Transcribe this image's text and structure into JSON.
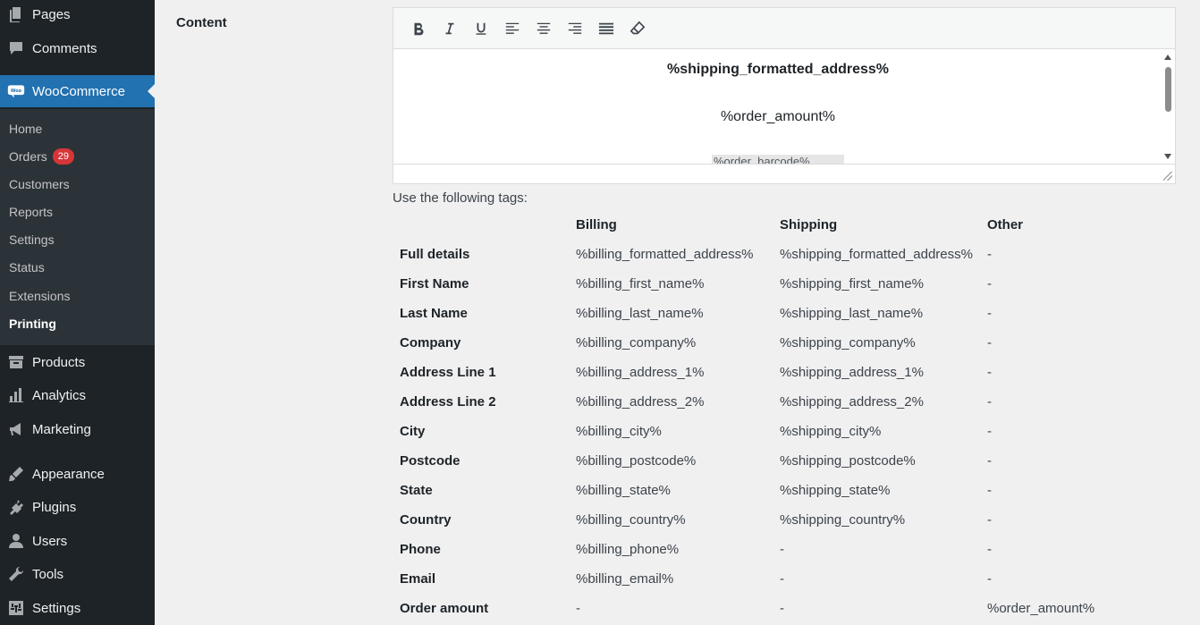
{
  "sidebar": {
    "top_items": [
      {
        "label": "Pages",
        "icon": "pages-icon"
      },
      {
        "label": "Comments",
        "icon": "comments-icon"
      }
    ],
    "woocommerce": {
      "label": "WooCommerce",
      "icon": "woocommerce-icon",
      "logo_text": "Woo"
    },
    "submenu": [
      {
        "label": "Home"
      },
      {
        "label": "Orders",
        "badge": "29"
      },
      {
        "label": "Customers"
      },
      {
        "label": "Reports"
      },
      {
        "label": "Settings"
      },
      {
        "label": "Status"
      },
      {
        "label": "Extensions"
      },
      {
        "label": "Printing",
        "current": true
      }
    ],
    "bottom_items": [
      {
        "label": "Products",
        "icon": "products-icon"
      },
      {
        "label": "Analytics",
        "icon": "analytics-icon"
      },
      {
        "label": "Marketing",
        "icon": "marketing-icon"
      },
      {
        "label": "Appearance",
        "icon": "appearance-icon"
      },
      {
        "label": "Plugins",
        "icon": "plugins-icon"
      },
      {
        "label": "Users",
        "icon": "users-icon"
      },
      {
        "label": "Tools",
        "icon": "tools-icon"
      },
      {
        "label": "Settings",
        "icon": "settings-icon"
      }
    ]
  },
  "content": {
    "label": "Content",
    "toolbar": [
      "bold-icon",
      "italic-icon",
      "underline-icon",
      "align-left-icon",
      "align-center-icon",
      "align-right-icon",
      "justify-icon",
      "clear-format-icon"
    ],
    "editor_lines": [
      "%shipping_formatted_address%",
      "%order_amount%",
      "%order_barcode%"
    ],
    "tags_hint": "Use the following tags:"
  },
  "tags_table": {
    "headers": [
      "",
      "Billing",
      "Shipping",
      "Other"
    ],
    "rows": [
      [
        "Full details",
        "%billing_formatted_address%",
        "%shipping_formatted_address%",
        "-"
      ],
      [
        "First Name",
        "%billing_first_name%",
        "%shipping_first_name%",
        "-"
      ],
      [
        "Last Name",
        "%billing_last_name%",
        "%shipping_last_name%",
        "-"
      ],
      [
        "Company",
        "%billing_company%",
        "%shipping_company%",
        "-"
      ],
      [
        "Address Line 1",
        "%billing_address_1%",
        "%shipping_address_1%",
        "-"
      ],
      [
        "Address Line 2",
        "%billing_address_2%",
        "%shipping_address_2%",
        "-"
      ],
      [
        "City",
        "%billing_city%",
        "%shipping_city%",
        "-"
      ],
      [
        "Postcode",
        "%billing_postcode%",
        "%shipping_postcode%",
        "-"
      ],
      [
        "State",
        "%billing_state%",
        "%shipping_state%",
        "-"
      ],
      [
        "Country",
        "%billing_country%",
        "%shipping_country%",
        "-"
      ],
      [
        "Phone",
        "%billing_phone%",
        "-",
        "-"
      ],
      [
        "Email",
        "%billing_email%",
        "-",
        "-"
      ],
      [
        "Order amount",
        "-",
        "-",
        "%order_amount%"
      ]
    ]
  },
  "colors": {
    "sidebar_bg": "#1d2327",
    "submenu_bg": "#2c3338",
    "accent": "#2271b1",
    "badge": "#d63638",
    "page_bg": "#f0f0f1"
  }
}
